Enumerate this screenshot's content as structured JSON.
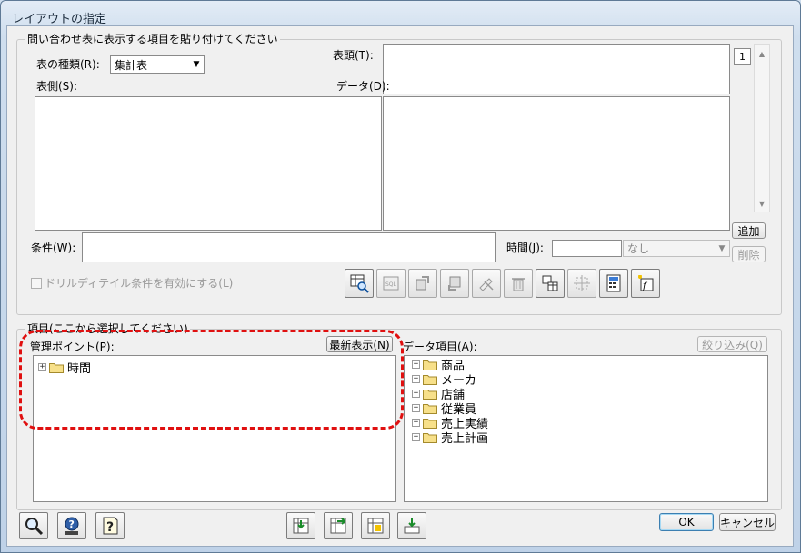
{
  "window": {
    "title": "レイアウトの指定"
  },
  "paste_group": {
    "legend": "問い合わせ表に表示する項目を貼り付けてください",
    "table_type_label": "表の種類(R):",
    "table_type_value": "集計表",
    "header_label": "表頭(T):",
    "side_label": "表側(S):",
    "data_label": "データ(D):",
    "page_number": "1",
    "add_button": "追加",
    "delete_button": "削除",
    "condition_label": "条件(W):",
    "time_label": "時間(J):",
    "time_value": "",
    "time_select": "なし",
    "drill_checkbox_label": "ドリルディテイル条件を有効にする(L)",
    "toolbar_icons": [
      "preview-icon",
      "sql-icon",
      "copy-icon",
      "paste-icon",
      "clear-icon",
      "trash-icon",
      "layout-icon",
      "move-icon",
      "calculator-icon",
      "function-icon"
    ]
  },
  "items_group": {
    "legend": "項目(ここから選択してください)",
    "management_label": "管理ポイント(P):",
    "refresh_button": "最新表示(N)",
    "data_items_label": "データ項目(A):",
    "narrow_button": "絞り込み(Q)",
    "management_tree": [
      {
        "label": "時間"
      }
    ],
    "data_tree": [
      {
        "label": "商品"
      },
      {
        "label": "メーカ"
      },
      {
        "label": "店舗"
      },
      {
        "label": "従業員"
      },
      {
        "label": "売上実績"
      },
      {
        "label": "売上計画"
      }
    ]
  },
  "footer": {
    "ok_button": "OK",
    "cancel_button": "キャンセル",
    "left_icons": [
      "search-icon",
      "user-help-icon",
      "help-icon"
    ],
    "middle_icons": [
      "add-to-side-icon",
      "add-to-header-icon",
      "add-to-data-icon",
      "add-to-condition-icon"
    ]
  },
  "colors": {
    "highlight": "#e01010",
    "accent": "#3c7fb1"
  }
}
